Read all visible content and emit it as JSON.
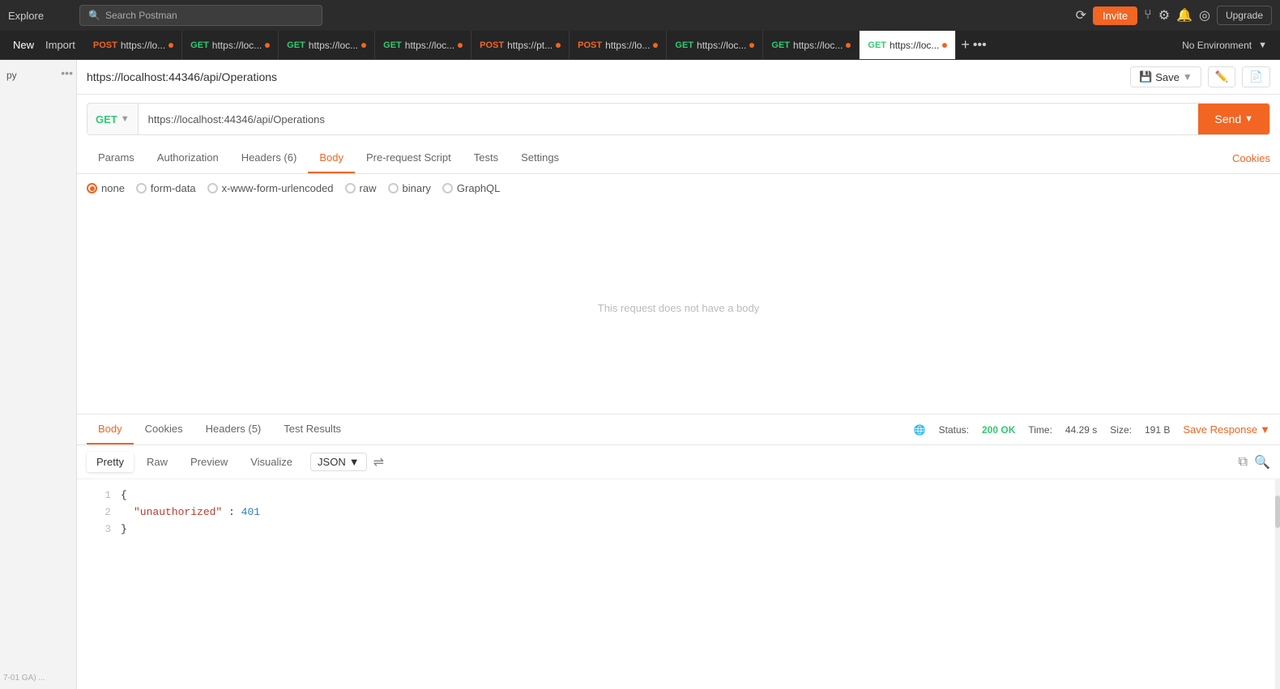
{
  "topbar": {
    "explore_label": "Explore",
    "search_placeholder": "Search Postman",
    "invite_label": "Invite",
    "upgrade_label": "Upgrade"
  },
  "tabs": {
    "new_label": "New",
    "import_label": "Import",
    "items": [
      {
        "method": "POST",
        "url": "https://lo...",
        "dot": "orange",
        "active": false
      },
      {
        "method": "GET",
        "url": "https://loc...",
        "dot": "orange",
        "active": false
      },
      {
        "method": "GET",
        "url": "https://loc...",
        "dot": "orange",
        "active": false
      },
      {
        "method": "GET",
        "url": "https://loc...",
        "dot": "orange",
        "active": false
      },
      {
        "method": "POST",
        "url": "https://pt...",
        "dot": "orange",
        "active": false
      },
      {
        "method": "POST",
        "url": "https://lo...",
        "dot": "orange",
        "active": false
      },
      {
        "method": "GET",
        "url": "https://loc...",
        "dot": "orange",
        "active": false
      },
      {
        "method": "GET",
        "url": "https://loc...",
        "dot": "orange",
        "active": false
      },
      {
        "method": "GET",
        "url": "https://loc...",
        "dot": "orange",
        "active": true
      }
    ]
  },
  "sidebar": {
    "dots_icon": "•••",
    "item_text": "py"
  },
  "request": {
    "url_display": "https://localhost:44346/api/Operations",
    "save_label": "Save",
    "method": "GET",
    "url_value": "https://localhost:44346/api/Operations",
    "send_label": "Send"
  },
  "req_tabs": {
    "items": [
      "Params",
      "Authorization",
      "Headers (6)",
      "Body",
      "Pre-request Script",
      "Tests",
      "Settings"
    ],
    "active": "Body",
    "cookies_label": "Cookies"
  },
  "body_options": {
    "items": [
      "none",
      "form-data",
      "x-www-form-urlencoded",
      "raw",
      "binary",
      "GraphQL"
    ],
    "selected": "none"
  },
  "no_body_message": "This request does not have a body",
  "response": {
    "tabs": [
      "Body",
      "Cookies",
      "Headers (5)",
      "Test Results"
    ],
    "active_tab": "Body",
    "status_label": "Status:",
    "status_value": "200 OK",
    "time_label": "Time:",
    "time_value": "44.29 s",
    "size_label": "Size:",
    "size_value": "191 B",
    "save_response_label": "Save Response",
    "format_tabs": [
      "Pretty",
      "Raw",
      "Preview",
      "Visualize"
    ],
    "active_format": "Pretty",
    "json_format": "JSON",
    "code_lines": [
      {
        "num": 1,
        "content": "{"
      },
      {
        "num": 2,
        "content": "  \"unauthorized\": 401"
      },
      {
        "num": 3,
        "content": "}"
      }
    ]
  },
  "statusbar": {
    "version_text": "7-01 GA) ...",
    "cursor_position": ""
  },
  "colors": {
    "orange": "#f26522",
    "green": "#2ecc71",
    "dark_bg": "#2c2c2c",
    "tab_bg": "#252525"
  }
}
